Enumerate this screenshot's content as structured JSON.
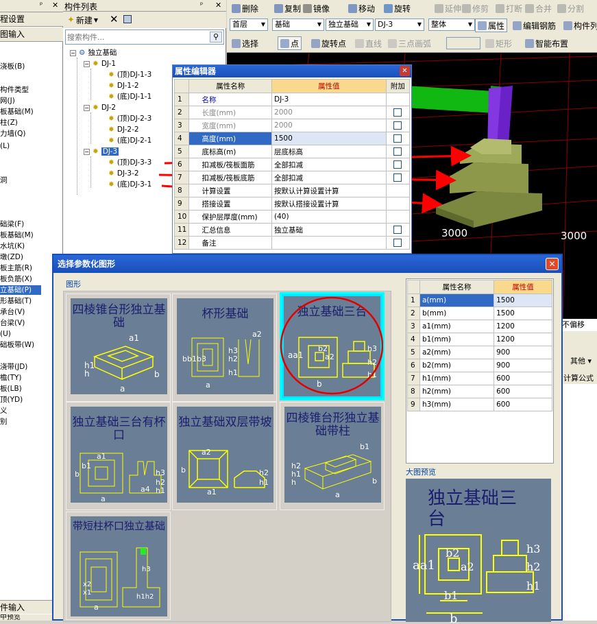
{
  "left_panel": {
    "items": [
      "程设置",
      "图输入",
      "构件类型",
      "网(J)",
      "板基础(M)",
      "柱(Z)",
      "力墙(Q)",
      "(L)",
      "浇板(B)",
      "",
      "",
      "洞",
      "",
      "",
      "础梁(F)",
      "板基础(M)",
      "水坑(K)",
      "墩(ZD)",
      "板主筋(R)",
      "板负筋(X)",
      "立基础(P)",
      "形基础(T)",
      "承台(V)",
      "台梁(V)",
      "(U)",
      "础板带(W)",
      "",
      "浇带(JD)",
      "檐(TY)",
      "板(LB)",
      "顶(YD)",
      "义",
      "别"
    ],
    "bottom": [
      "件输入",
      "中预览"
    ]
  },
  "component_panel": {
    "title": "构件列表",
    "new_label": "新建",
    "search_placeholder": "搜索构件...",
    "tree": [
      "独立基础",
      "DJ-1",
      "(顶)DJ-1-3",
      "DJ-1-2",
      "(底)DJ-1-1",
      "DJ-2",
      "(顶)DJ-2-3",
      "DJ-2-2",
      "(底)DJ-2-1",
      "DJ-3",
      "(顶)DJ-3-3",
      "DJ-3-2",
      "(底)DJ-3-1"
    ]
  },
  "toolbar": {
    "row1": [
      "删除",
      "复制",
      "镜像",
      "移动",
      "旋转",
      "延伸",
      "修剪",
      "打断",
      "合并",
      "分割"
    ],
    "combos": [
      "首层",
      "基础",
      "独立基础",
      "DJ-3",
      "整体"
    ],
    "row2_right": [
      "属性",
      "编辑钢筋",
      "构件列"
    ],
    "row3": [
      "选择",
      "点",
      "旋转点",
      "直线",
      "三点画弧",
      "矩形",
      "智能布置"
    ]
  },
  "viewport": {
    "labels": [
      "3000",
      "3000"
    ],
    "side": [
      "不偏移",
      "其他",
      "计算公式"
    ]
  },
  "prop_editor": {
    "title": "属性编辑器",
    "headers": [
      "属性名称",
      "属性值",
      "附加"
    ],
    "rows": [
      {
        "n": "1",
        "name": "名称",
        "value": "DJ-3",
        "gray": false,
        "chk": false
      },
      {
        "n": "2",
        "name": "长度(mm)",
        "value": "2000",
        "gray": true,
        "chk": true
      },
      {
        "n": "3",
        "name": "宽度(mm)",
        "value": "2000",
        "gray": true,
        "chk": true
      },
      {
        "n": "4",
        "name": "高度(mm)",
        "value": "1500",
        "gray": false,
        "chk": true
      },
      {
        "n": "5",
        "name": "底标高(m)",
        "value": "层底标高",
        "gray": false,
        "chk": true
      },
      {
        "n": "6",
        "name": "扣减板/筏板面筋",
        "value": "全部扣减",
        "gray": false,
        "chk": true
      },
      {
        "n": "7",
        "name": "扣减板/筏板底筋",
        "value": "全部扣减",
        "gray": false,
        "chk": true
      },
      {
        "n": "8",
        "name": "计算设置",
        "value": "按默认计算设置计算",
        "gray": false,
        "chk": false
      },
      {
        "n": "9",
        "name": "搭接设置",
        "value": "按默认搭接设置计算",
        "gray": false,
        "chk": false
      },
      {
        "n": "10",
        "name": "保护层厚度(mm)",
        "value": "(40)",
        "gray": false,
        "chk": false
      },
      {
        "n": "11",
        "name": "汇总信息",
        "value": "独立基础",
        "gray": false,
        "chk": true
      },
      {
        "n": "12",
        "name": "备注",
        "value": "",
        "gray": false,
        "chk": true
      }
    ]
  },
  "dialog": {
    "title": "选择参数化图形",
    "shapes_label": "图形",
    "preview_label": "大图预览",
    "shapes": [
      "四棱锥台形独立基础",
      "杯形基础",
      "独立基础三台",
      "独立基础三台有杯口",
      "独立基础双层带坡",
      "四棱锥台形独立基础带柱",
      "带短柱杯口独立基础"
    ],
    "headers": [
      "属性名称",
      "属性值"
    ],
    "params": [
      {
        "n": "1",
        "name": "a(mm)",
        "value": "1500"
      },
      {
        "n": "2",
        "name": "b(mm)",
        "value": "1500"
      },
      {
        "n": "3",
        "name": "a1(mm)",
        "value": "1200"
      },
      {
        "n": "4",
        "name": "b1(mm)",
        "value": "1200"
      },
      {
        "n": "5",
        "name": "a2(mm)",
        "value": "900"
      },
      {
        "n": "6",
        "name": "b2(mm)",
        "value": "900"
      },
      {
        "n": "7",
        "name": "h1(mm)",
        "value": "600"
      },
      {
        "n": "8",
        "name": "h2(mm)",
        "value": "600"
      },
      {
        "n": "9",
        "name": "h3(mm)",
        "value": "600"
      }
    ]
  },
  "colors": {
    "title_blue": "#1a4fb8",
    "highlight": "#316ac5",
    "thumb_bg": "#6a7e96",
    "select_cyan": "#00ffff",
    "arrow_red": "#ff0000"
  }
}
